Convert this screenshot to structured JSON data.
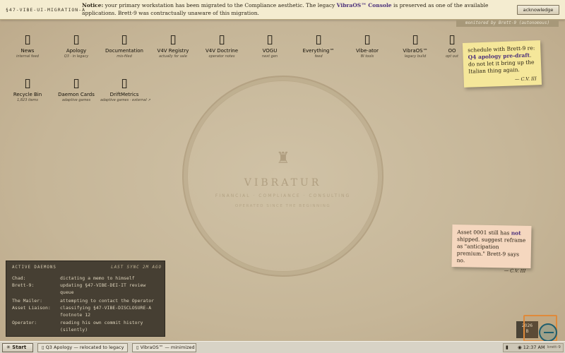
{
  "notice": {
    "tag": "§47-VIBE-UI-MIGRATION-A",
    "lead": "Notice:",
    "pre": " your primary workstation has been migrated to the Compliance aesthetic. The legacy ",
    "app": "VibraOS™ Console",
    "post": " is preserved as one of the available applications. Brett-9 was contractually unaware of this migration.",
    "ack_label": "acknowledge"
  },
  "monitored_label": "monitored by Brett-9 (autonomous)",
  "seal": {
    "mark": "♜",
    "word": "VIBRATUR",
    "sub": "FINANCIAL · COMPLIANCE · CONSULTING",
    "sub2": "OPERATED SINCE THE BEGINNING"
  },
  "desktop_icons": [
    {
      "glyph": "▯",
      "label": "News",
      "sub": "internal feed"
    },
    {
      "glyph": "▯",
      "label": "Apology",
      "sub": "Q3 · in legacy"
    },
    {
      "glyph": "▯",
      "label": "Documentation",
      "sub": "mis-filed"
    },
    {
      "glyph": "▯",
      "label": "V4V Registry",
      "sub": "actually for sale"
    },
    {
      "glyph": "▯",
      "label": "V4V Doctrine",
      "sub": "operator notes"
    },
    {
      "glyph": "▯",
      "label": "VOGU",
      "sub": "next gen"
    },
    {
      "glyph": "▯",
      "label": "Everything™",
      "sub": "feed"
    },
    {
      "glyph": "▯",
      "label": "Vibe-ator",
      "sub": "BI tools"
    },
    {
      "glyph": "▯",
      "label": "VibraOS™",
      "sub": "legacy build"
    },
    {
      "glyph": "▯",
      "label": "OO",
      "sub": "opt out"
    },
    {
      "glyph": "▯",
      "label": "Recycle Bin",
      "sub": "1,823 items"
    },
    {
      "glyph": "▯",
      "label": "Daemon Cards",
      "sub": "adaptive games"
    },
    {
      "glyph": "▯",
      "label": "DriftMetrics",
      "sub": "adaptive games · external ↗"
    }
  ],
  "sticky_yellow": {
    "pre": "schedule with Brett-9 re: ",
    "em": "Q4 apology pre-draft",
    "post": ". do not let it bring up the Italian thing again.",
    "sig": "— C.V. III"
  },
  "sticky_peach": {
    "pre": "Asset 0001 still has ",
    "em": "not",
    "post": " shipped. suggest reframe as \"anticipation premium.\" Brett-9 says no.",
    "sig": "— C.V. III"
  },
  "daemons": {
    "title": "ACTIVE DAEMONS",
    "sync": "LAST SYNC 2M AGO",
    "rows": [
      {
        "who": "Chad:",
        "what": "dictating a memo to himself"
      },
      {
        "who": "Brett-9:",
        "what": "updating §47-VIBE-DEI-IT review queue"
      },
      {
        "who": "The Mailer:",
        "what": "attempting to contact the Operator"
      },
      {
        "who": "Asset Liaison:",
        "what": "classifying §47-VIBE-DISCLOSURE-A footnote 12"
      },
      {
        "who": "Operator:",
        "what": "reading his own commit history (silently)"
      }
    ]
  },
  "year_widget": {
    "year": "2026",
    "sub": "B"
  },
  "taskbar": {
    "start_label": "✳ Start",
    "task1": "▯ Q3 Apology — relocated to legacy",
    "task2": "▯ VibraOS™ — minimized",
    "signal_icon": "▮",
    "clock": "◉ 12:37 AM",
    "user": "brett-9"
  },
  "colors": {
    "accent": "#4a2f7a",
    "sticky_yellow": "#f5e79a",
    "sticky_peach": "#f5d7bf",
    "panel": "#463f33"
  }
}
